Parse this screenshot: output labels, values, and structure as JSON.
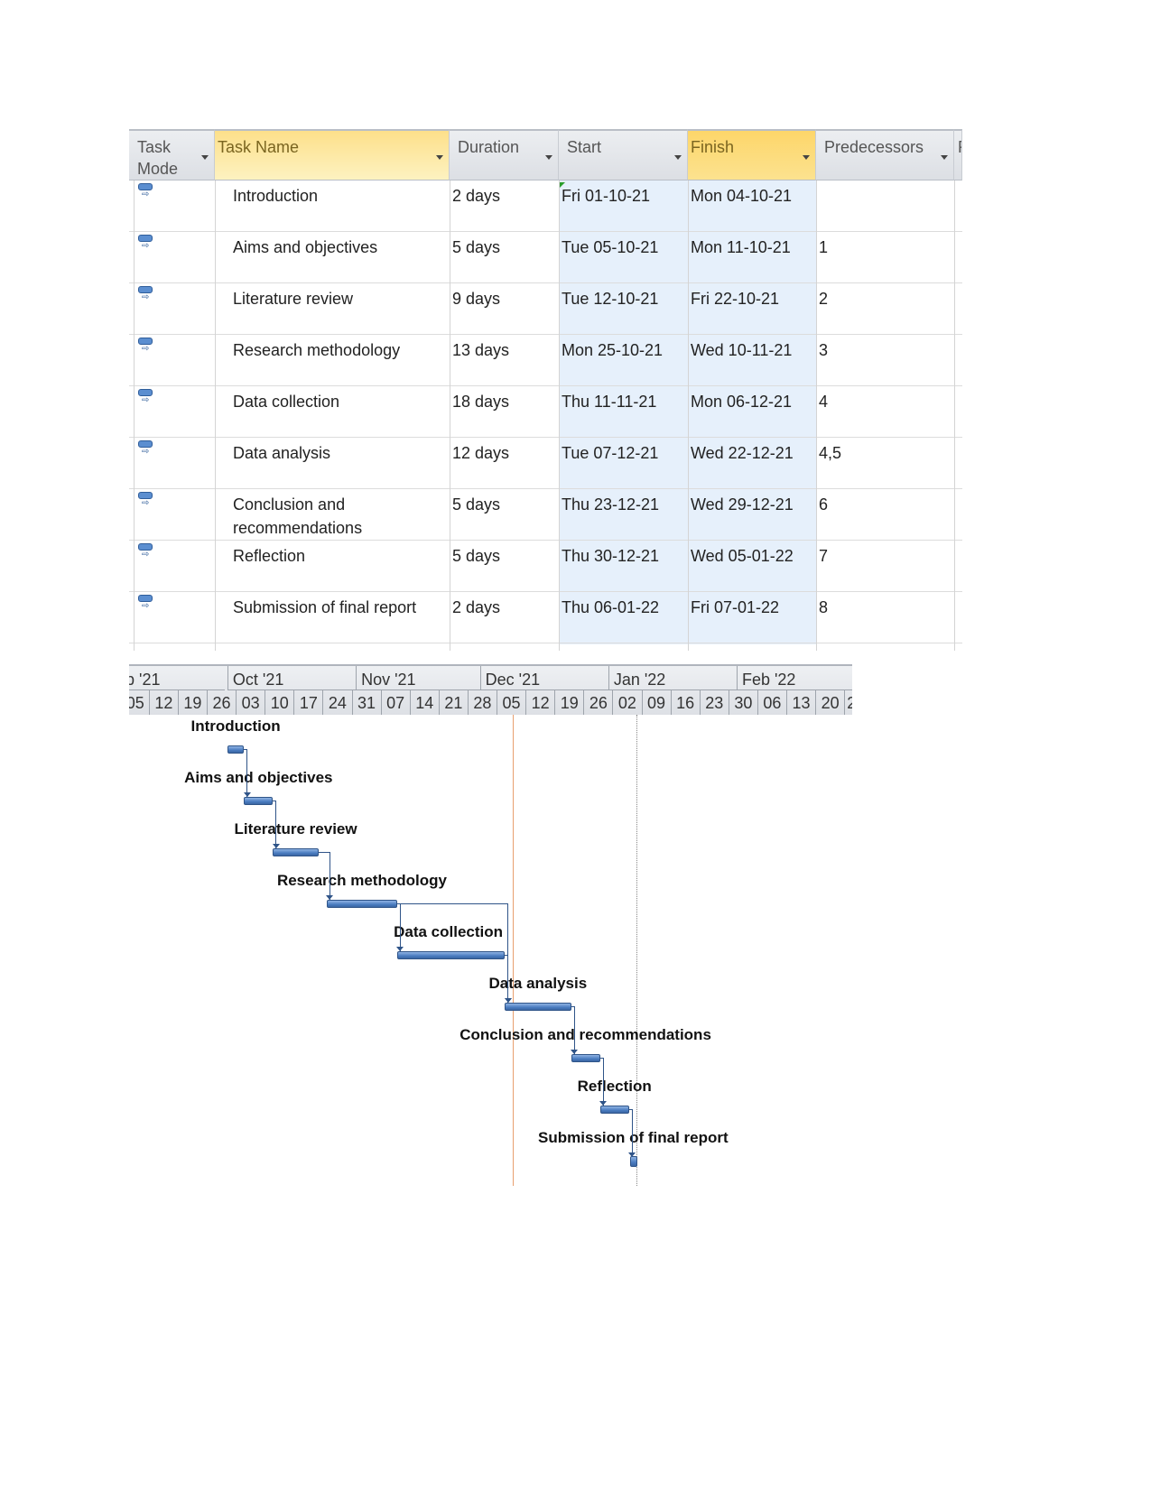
{
  "table": {
    "columns": [
      {
        "label": "Task Mode",
        "id": "mode"
      },
      {
        "label": "Task Name",
        "id": "name"
      },
      {
        "label": "Duration",
        "id": "duration"
      },
      {
        "label": "Start",
        "id": "start"
      },
      {
        "label": "Finish",
        "id": "finish"
      },
      {
        "label": "Predecessors",
        "id": "pred"
      },
      {
        "label": "R",
        "id": "next"
      }
    ],
    "task_mode_icon": "auto-scheduled-task-icon",
    "rows": [
      {
        "name": "Introduction",
        "duration": "2 days",
        "start": "Fri 01-10-21",
        "finish": "Mon 04-10-21",
        "pred": ""
      },
      {
        "name": "Aims and objectives",
        "duration": "5 days",
        "start": "Tue 05-10-21",
        "finish": "Mon 11-10-21",
        "pred": "1"
      },
      {
        "name": "Literature review",
        "duration": "9 days",
        "start": "Tue 12-10-21",
        "finish": "Fri 22-10-21",
        "pred": "2"
      },
      {
        "name": "Research methodology",
        "duration": "13 days",
        "start": "Mon 25-10-21",
        "finish": "Wed 10-11-21",
        "pred": "3"
      },
      {
        "name": "Data collection",
        "duration": "18 days",
        "start": "Thu 11-11-21",
        "finish": "Mon 06-12-21",
        "pred": "4"
      },
      {
        "name": "Data analysis",
        "duration": "12 days",
        "start": "Tue 07-12-21",
        "finish": "Wed 22-12-21",
        "pred": "4,5"
      },
      {
        "name": "Conclusion and recommendations",
        "duration": "5 days",
        "start": "Thu 23-12-21",
        "finish": "Wed 29-12-21",
        "pred": "6"
      },
      {
        "name": "Reflection",
        "duration": "5 days",
        "start": "Thu 30-12-21",
        "finish": "Wed 05-01-22",
        "pred": "7"
      },
      {
        "name": "Submission of final report",
        "duration": "2 days",
        "start": "Thu 06-01-22",
        "finish": "Fri 07-01-22",
        "pred": "8"
      }
    ]
  },
  "timescale": {
    "months": [
      "p '21",
      "Oct '21",
      "Nov '21",
      "Dec '21",
      "Jan '22",
      "Feb '22"
    ],
    "weeks": [
      "05",
      "12",
      "19",
      "26",
      "03",
      "10",
      "17",
      "24",
      "31",
      "07",
      "14",
      "21",
      "28",
      "05",
      "12",
      "19",
      "26",
      "02",
      "09",
      "16",
      "23",
      "30",
      "06",
      "13",
      "20",
      "2"
    ]
  },
  "colors": {
    "bar": "#4a7cc0",
    "status_line": "#e8a070",
    "selected_header": "#fdd66a",
    "date_column": "#e6f0fb"
  }
}
